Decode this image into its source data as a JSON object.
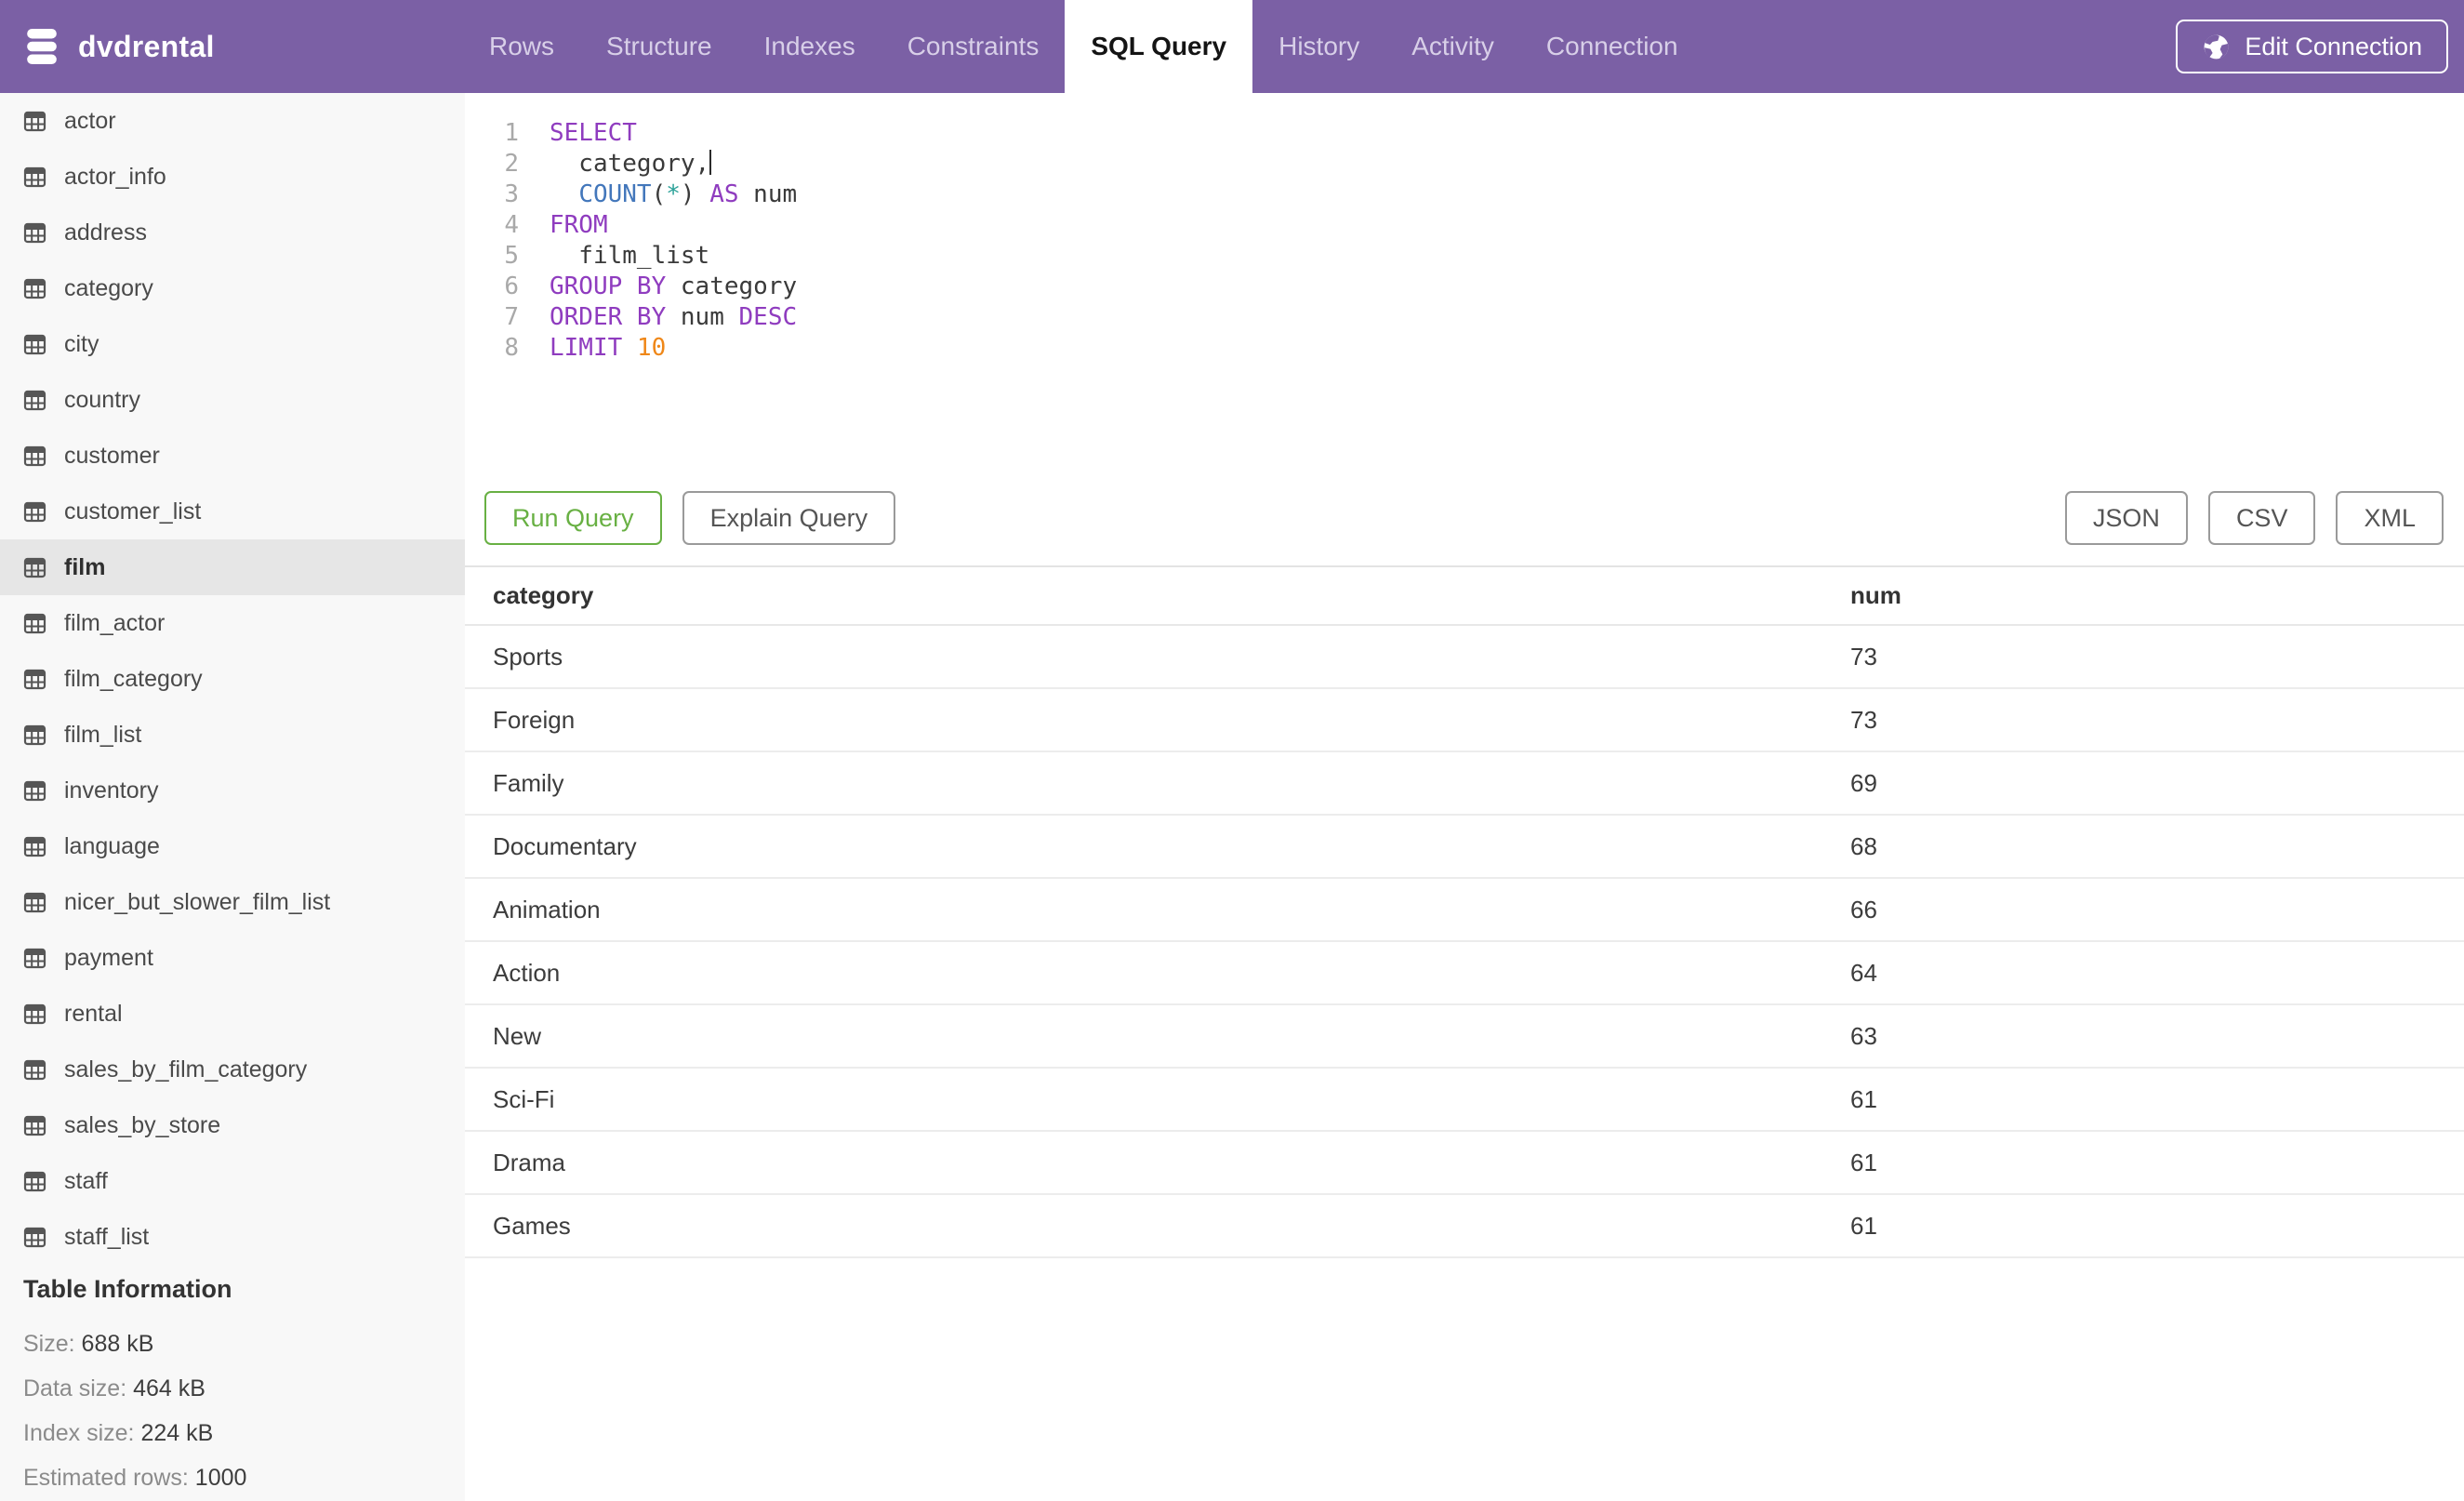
{
  "colors": {
    "header_bg": "#7b60a5",
    "active_tab_bg": "#ffffff",
    "run_button_green": "#68b043",
    "keyword_purple": "#8f3cbf",
    "function_blue": "#4377bb",
    "star_teal": "#2aa198",
    "number_orange": "#ef8718"
  },
  "header": {
    "database_name": "dvdrental",
    "tabs": [
      {
        "label": "Rows",
        "active": false
      },
      {
        "label": "Structure",
        "active": false
      },
      {
        "label": "Indexes",
        "active": false
      },
      {
        "label": "Constraints",
        "active": false
      },
      {
        "label": "SQL Query",
        "active": true
      },
      {
        "label": "History",
        "active": false
      },
      {
        "label": "Activity",
        "active": false
      },
      {
        "label": "Connection",
        "active": false
      }
    ],
    "edit_connection_label": "Edit Connection"
  },
  "sidebar": {
    "tables": [
      {
        "name": "actor",
        "selected": false
      },
      {
        "name": "actor_info",
        "selected": false
      },
      {
        "name": "address",
        "selected": false
      },
      {
        "name": "category",
        "selected": false
      },
      {
        "name": "city",
        "selected": false
      },
      {
        "name": "country",
        "selected": false
      },
      {
        "name": "customer",
        "selected": false
      },
      {
        "name": "customer_list",
        "selected": false
      },
      {
        "name": "film",
        "selected": true
      },
      {
        "name": "film_actor",
        "selected": false
      },
      {
        "name": "film_category",
        "selected": false
      },
      {
        "name": "film_list",
        "selected": false
      },
      {
        "name": "inventory",
        "selected": false
      },
      {
        "name": "language",
        "selected": false
      },
      {
        "name": "nicer_but_slower_film_list",
        "selected": false
      },
      {
        "name": "payment",
        "selected": false
      },
      {
        "name": "rental",
        "selected": false
      },
      {
        "name": "sales_by_film_category",
        "selected": false
      },
      {
        "name": "sales_by_store",
        "selected": false
      },
      {
        "name": "staff",
        "selected": false
      },
      {
        "name": "staff_list",
        "selected": false
      }
    ],
    "table_information": {
      "heading": "Table Information",
      "stats": [
        {
          "label": "Size:",
          "value": "688 kB"
        },
        {
          "label": "Data size:",
          "value": "464 kB"
        },
        {
          "label": "Index size:",
          "value": "224 kB"
        },
        {
          "label": "Estimated rows:",
          "value": "1000"
        }
      ]
    }
  },
  "editor": {
    "lines": [
      {
        "number": "1",
        "tokens": [
          {
            "text": "SELECT",
            "type": "kw"
          }
        ]
      },
      {
        "number": "2",
        "tokens": [
          {
            "text": "  category,",
            "type": "pl"
          },
          {
            "text": "",
            "type": "cursor"
          }
        ]
      },
      {
        "number": "3",
        "tokens": [
          {
            "text": "  ",
            "type": "pl"
          },
          {
            "text": "COUNT",
            "type": "fn"
          },
          {
            "text": "(",
            "type": "pl"
          },
          {
            "text": "*",
            "type": "star"
          },
          {
            "text": ")",
            "type": "pl"
          },
          {
            "text": " ",
            "type": "pl"
          },
          {
            "text": "AS",
            "type": "kw"
          },
          {
            "text": " num",
            "type": "pl"
          }
        ]
      },
      {
        "number": "4",
        "tokens": [
          {
            "text": "FROM",
            "type": "kw"
          }
        ]
      },
      {
        "number": "5",
        "tokens": [
          {
            "text": "  film_list",
            "type": "pl"
          }
        ]
      },
      {
        "number": "6",
        "tokens": [
          {
            "text": "GROUP BY",
            "type": "kw"
          },
          {
            "text": " category",
            "type": "pl"
          }
        ]
      },
      {
        "number": "7",
        "tokens": [
          {
            "text": "ORDER BY",
            "type": "kw"
          },
          {
            "text": " num ",
            "type": "pl"
          },
          {
            "text": "DESC",
            "type": "kw"
          }
        ]
      },
      {
        "number": "8",
        "tokens": [
          {
            "text": "LIMIT",
            "type": "kw"
          },
          {
            "text": " ",
            "type": "pl"
          },
          {
            "text": "10",
            "type": "num"
          }
        ]
      }
    ]
  },
  "actions": {
    "run_label": "Run Query",
    "explain_label": "Explain Query",
    "export_buttons": [
      {
        "label": "JSON"
      },
      {
        "label": "CSV"
      },
      {
        "label": "XML"
      }
    ]
  },
  "results": {
    "columns": [
      "category",
      "num"
    ],
    "rows": [
      {
        "category": "Sports",
        "num": "73"
      },
      {
        "category": "Foreign",
        "num": "73"
      },
      {
        "category": "Family",
        "num": "69"
      },
      {
        "category": "Documentary",
        "num": "68"
      },
      {
        "category": "Animation",
        "num": "66"
      },
      {
        "category": "Action",
        "num": "64"
      },
      {
        "category": "New",
        "num": "63"
      },
      {
        "category": "Sci-Fi",
        "num": "61"
      },
      {
        "category": "Drama",
        "num": "61"
      },
      {
        "category": "Games",
        "num": "61"
      }
    ]
  }
}
